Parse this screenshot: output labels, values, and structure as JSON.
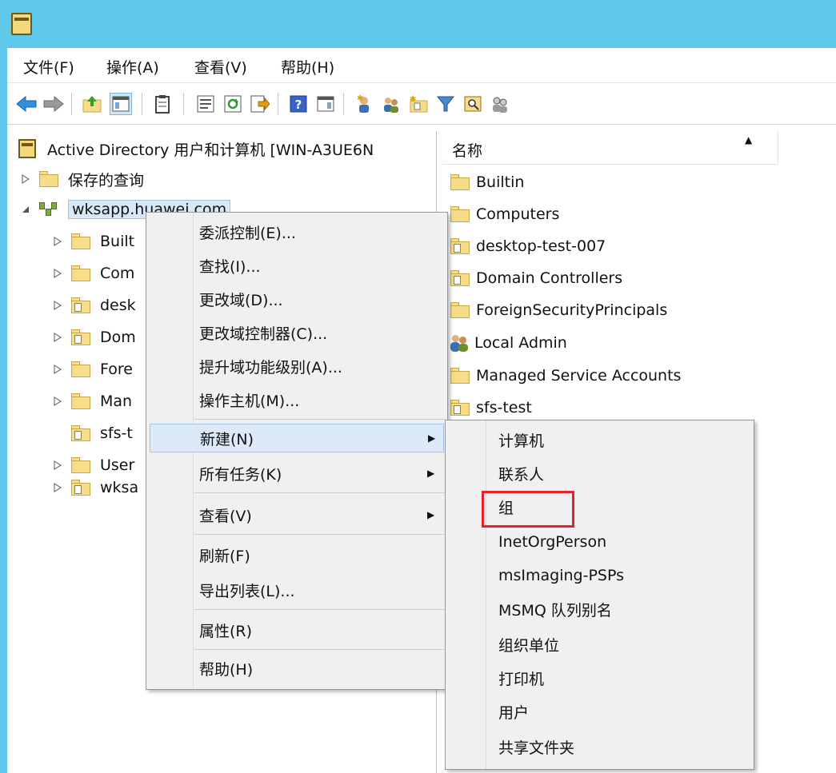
{
  "menubar": {
    "items": [
      "文件(F)",
      "操作(A)",
      "查看(V)",
      "帮助(H)"
    ]
  },
  "toolbar": {
    "icons": [
      "back-arrow-icon",
      "forward-arrow-icon",
      "up-folder-icon",
      "show-console-tree-icon",
      "clipboard-icon",
      "properties-icon",
      "refresh-icon",
      "export-list-icon",
      "help-icon",
      "action-pane-icon",
      "new-user-icon",
      "new-group-icon",
      "new-ou-icon",
      "filter-icon",
      "find-icon",
      "add-to-group-icon"
    ]
  },
  "tree": {
    "root": "Active Directory 用户和计算机 [WIN-A3UE6N",
    "saved_queries": "保存的查询",
    "domain": "wksapp.huawei.com",
    "children": [
      "Built",
      "Com",
      "desk",
      "Dom",
      "Fore",
      "Man",
      "sfs-t",
      "User",
      "wksa"
    ]
  },
  "list": {
    "header": "名称",
    "items": [
      "Builtin",
      "Computers",
      "desktop-test-007",
      "Domain Controllers",
      "ForeignSecurityPrincipals",
      "Local Admin",
      "Managed Service Accounts",
      "sfs-test"
    ]
  },
  "context_menu": {
    "items": [
      "委派控制(E)...",
      "查找(I)...",
      "更改域(D)...",
      "更改域控制器(C)...",
      "提升域功能级别(A)...",
      "操作主机(M)...",
      "新建(N)",
      "所有任务(K)",
      "查看(V)",
      "刷新(F)",
      "导出列表(L)...",
      "属性(R)",
      "帮助(H)"
    ],
    "arrow": "▶"
  },
  "submenu": {
    "items": [
      "计算机",
      "联系人",
      "组",
      "InetOrgPerson",
      "msImaging-PSPs",
      "MSMQ 队列别名",
      "组织单位",
      "打印机",
      "用户",
      "共享文件夹"
    ]
  },
  "colors": {
    "titlebar": "#5fc9eb",
    "menu_highlight": "#dbe9f8",
    "annotation_box": "#e8202a"
  }
}
